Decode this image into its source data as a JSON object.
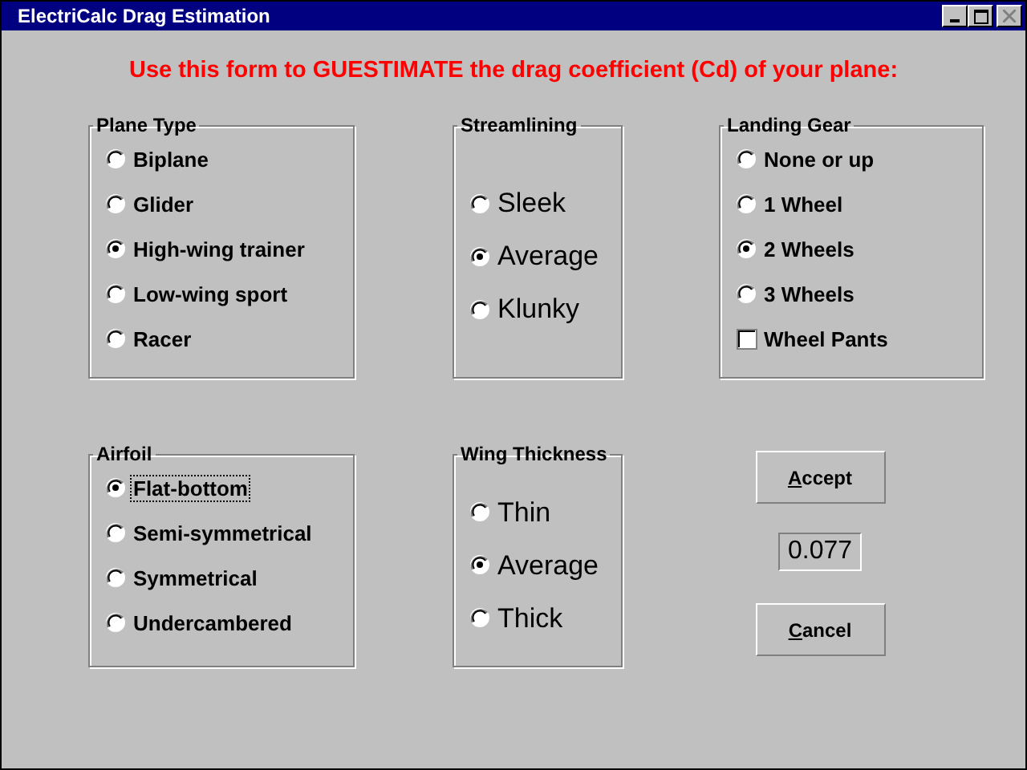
{
  "window": {
    "title": "ElectriCalc Drag Estimation"
  },
  "instruction": "Use this form to GUESTIMATE the drag coefficient (Cd) of your plane:",
  "groups": [
    {
      "title": "Plane Type",
      "options": [
        {
          "kind": "radio",
          "label": "Biplane",
          "selected": false,
          "focused": false
        },
        {
          "kind": "radio",
          "label": "Glider",
          "selected": false,
          "focused": false
        },
        {
          "kind": "radio",
          "label": "High-wing trainer",
          "selected": true,
          "focused": false
        },
        {
          "kind": "radio",
          "label": "Low-wing sport",
          "selected": false,
          "focused": false
        },
        {
          "kind": "radio",
          "label": "Racer",
          "selected": false,
          "focused": false
        }
      ]
    },
    {
      "title": "Streamlining",
      "options": [
        {
          "kind": "radio",
          "label": "Sleek",
          "selected": false,
          "focused": false
        },
        {
          "kind": "radio",
          "label": "Average",
          "selected": true,
          "focused": false
        },
        {
          "kind": "radio",
          "label": "Klunky",
          "selected": false,
          "focused": false
        }
      ]
    },
    {
      "title": "Landing Gear",
      "options": [
        {
          "kind": "radio",
          "label": "None or up",
          "selected": false,
          "focused": false
        },
        {
          "kind": "radio",
          "label": "1 Wheel",
          "selected": false,
          "focused": false
        },
        {
          "kind": "radio",
          "label": "2 Wheels",
          "selected": true,
          "focused": false
        },
        {
          "kind": "radio",
          "label": "3 Wheels",
          "selected": false,
          "focused": false
        },
        {
          "kind": "checkbox",
          "label": "Wheel Pants",
          "checked": false,
          "focused": false
        }
      ]
    },
    {
      "title": "Airfoil",
      "options": [
        {
          "kind": "radio",
          "label": "Flat-bottom",
          "selected": true,
          "focused": true
        },
        {
          "kind": "radio",
          "label": "Semi-symmetrical",
          "selected": false,
          "focused": false
        },
        {
          "kind": "radio",
          "label": "Symmetrical",
          "selected": false,
          "focused": false
        },
        {
          "kind": "radio",
          "label": "Undercambered",
          "selected": false,
          "focused": false
        }
      ]
    },
    {
      "title": "Wing Thickness",
      "options": [
        {
          "kind": "radio",
          "label": "Thin",
          "selected": false,
          "focused": false
        },
        {
          "kind": "radio",
          "label": "Average",
          "selected": true,
          "focused": false
        },
        {
          "kind": "radio",
          "label": "Thick",
          "selected": false,
          "focused": false
        }
      ]
    }
  ],
  "buttons": [
    {
      "label": "Accept"
    },
    {
      "label": "Cancel"
    }
  ],
  "result": "0.077"
}
